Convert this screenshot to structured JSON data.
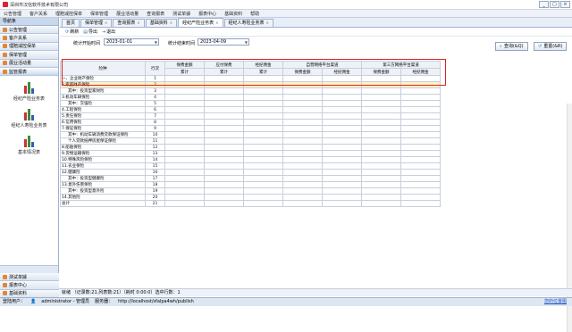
{
  "window": {
    "title": "深圳市汉信软件技术有限公司",
    "controls": [
      "_",
      "□",
      "×"
    ]
  },
  "menu": [
    "公告管理",
    "客户关系",
    "理赔减控保单",
    "保单管理",
    "展业活动量",
    "查询报表",
    "测试单據",
    "报表中心",
    "基础资料",
    "帮助"
  ],
  "sidebar": {
    "header": "导航条",
    "top_items": [
      "公告管理",
      "客户关系",
      "理赔减控保单",
      "保单管理",
      "展业活动量",
      "监管报表"
    ],
    "active_index": 5,
    "reports": [
      "经纪产险业务表",
      "经纪人寿险业务表",
      "基本情况表"
    ],
    "bottom_items": [
      "测试单據",
      "报表中心",
      "基础资料"
    ]
  },
  "tabs": [
    {
      "label": "首页",
      "closable": false
    },
    {
      "label": "保单管理",
      "closable": true
    },
    {
      "label": "查询报表",
      "closable": true
    },
    {
      "label": "基础资料",
      "closable": true
    },
    {
      "label": "经纪产险业务表",
      "closable": true
    },
    {
      "label": "经纪人寿险业务表",
      "closable": true
    }
  ],
  "active_tab": 4,
  "toolbar": {
    "refresh": "刷新",
    "export": "导出",
    "exit": "退出"
  },
  "filters": {
    "start_label": "统计开始时间",
    "start_value": "2023-01-01",
    "end_label": "统计结束时间",
    "end_value": "2023-04-09",
    "query_btn": "查询(&Q)",
    "reset_btn": "重置(&R)"
  },
  "table": {
    "head_row1": [
      "险种",
      "行次",
      "保费金额",
      "应付保费",
      "经纪佣金",
      "自营网络平台渠道",
      "",
      "第三方网络平台渠道",
      ""
    ],
    "head_row2": [
      "累计",
      "累计",
      "累计",
      "保费金额",
      "经纪佣金",
      "保费金额",
      "经纪佣金"
    ],
    "rows": [
      [
        "一、企业财产保险",
        "1"
      ],
      [
        "2.家庭财产保险",
        "2"
      ],
      [
        "其中：投资型家财险",
        "3"
      ],
      [
        "3.机动车辆保险",
        "4"
      ],
      [
        "其中：交强险",
        "5"
      ],
      [
        "4.工程保险",
        "6"
      ],
      [
        "5.责任保险",
        "7"
      ],
      [
        "6.信用保险",
        "8"
      ],
      [
        "7.保证保险",
        "9"
      ],
      [
        "其中：机动车辆消费贷款保证保险",
        "10"
      ],
      [
        "个人贷款抵押房屋保证保险",
        "11"
      ],
      [
        "8.船舶保险",
        "12"
      ],
      [
        "9.货物运输保险",
        "13"
      ],
      [
        "10.特殊风险保险",
        "14"
      ],
      [
        "11.农业保险",
        "15"
      ],
      [
        "12.健康险",
        "16"
      ],
      [
        "其中：投资型健康险",
        "17"
      ],
      [
        "13.意外伤害保险",
        "18"
      ],
      [
        "其中：投资型意外险",
        "19"
      ],
      [
        "14.其他险",
        "20"
      ],
      [
        "总计",
        "21"
      ]
    ],
    "indented_rows": [
      2,
      4,
      9,
      10,
      16,
      18
    ],
    "selected_row": 1
  },
  "status": {
    "grid": "就绪 （记录数:21,列表数:21）（耗时 0:00:0）选中行数：1",
    "login_label": "登陆用户：",
    "user": "administrator - 管理员",
    "server_label": "服务器：",
    "server": "http://localhost/sfalpa4wh/publish",
    "link": "您的位置图"
  }
}
